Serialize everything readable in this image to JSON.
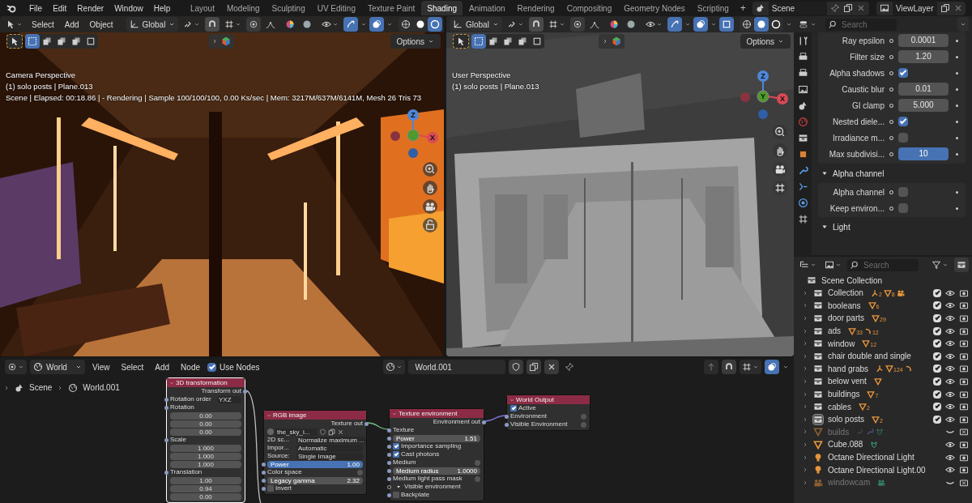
{
  "menu": [
    "File",
    "Edit",
    "Render",
    "Window",
    "Help"
  ],
  "workspaces": [
    {
      "label": "Layout",
      "selected": false
    },
    {
      "label": "Modeling",
      "selected": false
    },
    {
      "label": "Sculpting",
      "selected": false
    },
    {
      "label": "UV Editing",
      "selected": false
    },
    {
      "label": "Texture Paint",
      "selected": false
    },
    {
      "label": "Shading",
      "selected": true
    },
    {
      "label": "Animation",
      "selected": false
    },
    {
      "label": "Rendering",
      "selected": false
    },
    {
      "label": "Compositing",
      "selected": false
    },
    {
      "label": "Geometry Nodes",
      "selected": false
    },
    {
      "label": "Scripting",
      "selected": false
    }
  ],
  "add_workspace": "+",
  "scene_field": "Scene",
  "view_layer_field": "ViewLayer",
  "viewports": [
    {
      "menu": [
        "Select",
        "Add",
        "Object"
      ],
      "orientation": "Global",
      "options": "Options",
      "engine_panel_expanded": false,
      "shading": {
        "wireframe": false,
        "solid": false,
        "material": true
      },
      "overlay_lines": [
        "Camera Perspective",
        "(1) solo posts | Plane.013",
        "Scene | Elapsed: 00:18.86 |  - Rendering | Sample 100/100/100, 0.00 Ks/sec | Mem: 3217M/637M/6141M, Mesh 26 Tris 73"
      ],
      "gizmo_labels": [
        "Z",
        "X"
      ]
    },
    {
      "orientation": "Global",
      "options": "Options",
      "engine_panel_expanded": false,
      "shading": {
        "wireframe": false,
        "solid": true,
        "material": false
      },
      "overlay_lines": [
        "User Perspective",
        "(1) solo posts | Plane.013"
      ],
      "gizmo_labels": [
        "Z",
        "Y",
        "X"
      ]
    }
  ],
  "properties": {
    "search_placeholder": "Search",
    "rows": [
      {
        "kind": "number",
        "label": "Ray epsilon",
        "value": "0.0001",
        "active": false
      },
      {
        "kind": "number",
        "label": "Filter size",
        "value": "1.20",
        "active": false
      },
      {
        "kind": "checkbox",
        "label": "Alpha shadows",
        "checked": true
      },
      {
        "kind": "number",
        "label": "Caustic blur",
        "value": "0.01",
        "active": false
      },
      {
        "kind": "number",
        "label": "GI clamp",
        "value": "5.000",
        "active": false
      },
      {
        "kind": "checkbox",
        "label": "Nested diele...",
        "checked": true
      },
      {
        "kind": "checkbox",
        "label": "Irradiance m...",
        "checked": false
      },
      {
        "kind": "number",
        "label": "Max subdivisi...",
        "value": "10",
        "active": true
      }
    ],
    "panels": [
      {
        "title": "Alpha channel",
        "expanded": true,
        "rows": [
          {
            "kind": "checkbox",
            "label": "Alpha channel",
            "checked": false
          },
          {
            "kind": "checkbox",
            "label": "Keep environ...",
            "checked": false
          }
        ]
      },
      {
        "title": "Light",
        "expanded": true
      }
    ]
  },
  "outliner": {
    "search_placeholder": "Search",
    "root": "Scene Collection",
    "items": [
      {
        "kind": "collection",
        "name": "Collection",
        "included": true,
        "visible": true,
        "active": false,
        "badges": [
          {
            "kind": "armature",
            "count": "2"
          },
          {
            "kind": "mesh",
            "count": "8"
          },
          {
            "kind": "camera"
          }
        ]
      },
      {
        "kind": "collection",
        "name": "booleans",
        "included": true,
        "visible": true,
        "active": false,
        "badges": [
          {
            "kind": "mesh",
            "count": "6"
          }
        ]
      },
      {
        "kind": "collection",
        "name": "door parts",
        "included": true,
        "visible": true,
        "active": false,
        "badges": [
          {
            "kind": "mesh",
            "count": "29"
          }
        ]
      },
      {
        "kind": "collection",
        "name": "ads",
        "included": true,
        "visible": true,
        "active": false,
        "badges": [
          {
            "kind": "mesh",
            "count": "33"
          },
          {
            "kind": "curve",
            "count": "12"
          }
        ]
      },
      {
        "kind": "collection",
        "name": "window",
        "included": true,
        "visible": true,
        "active": false,
        "badges": [
          {
            "kind": "mesh",
            "count": "12"
          }
        ]
      },
      {
        "kind": "collection",
        "name": "chair double and single",
        "included": true,
        "visible": true,
        "active": false
      },
      {
        "kind": "collection",
        "name": "hand grabs",
        "included": true,
        "visible": true,
        "active": false,
        "badges": [
          {
            "kind": "armature"
          },
          {
            "kind": "mesh",
            "count": "124"
          },
          {
            "kind": "curve"
          }
        ]
      },
      {
        "kind": "collection",
        "name": "below vent",
        "included": true,
        "visible": true,
        "active": false,
        "badges": [
          {
            "kind": "mesh"
          }
        ]
      },
      {
        "kind": "collection",
        "name": "buildings",
        "included": true,
        "visible": true,
        "active": false,
        "badges": [
          {
            "kind": "mesh",
            "count": "7"
          }
        ]
      },
      {
        "kind": "collection",
        "name": "cables",
        "included": true,
        "visible": true,
        "active": false,
        "badges": [
          {
            "kind": "mesh",
            "count": "2"
          }
        ]
      },
      {
        "kind": "collection",
        "name": "solo posts",
        "included": true,
        "visible": true,
        "active": true,
        "badges": [
          {
            "kind": "mesh",
            "count": "2"
          }
        ]
      },
      {
        "kind": "mesh",
        "name": "builds",
        "visible": false,
        "active": false,
        "badges": [
          {
            "kind": "constraint"
          },
          {
            "kind": "modifier"
          },
          {
            "kind": "mesh_data"
          }
        ]
      },
      {
        "kind": "mesh",
        "name": "Cube.088",
        "visible": true,
        "active": false,
        "badges": [
          {
            "kind": "mesh_data"
          }
        ]
      },
      {
        "kind": "light",
        "name": "Octane Directional Light",
        "visible": true,
        "active": false
      },
      {
        "kind": "light",
        "name": "Octane Directional Light.00",
        "visible": true,
        "active": false
      },
      {
        "kind": "camera",
        "name": "windowcam",
        "visible": false,
        "active": false,
        "badges": [
          {
            "kind": "camera_data"
          }
        ]
      }
    ]
  },
  "node_editor": {
    "type_dropdown": "World",
    "menu": [
      "View",
      "Select",
      "Add",
      "Node"
    ],
    "use_nodes": {
      "label": "Use Nodes",
      "checked": true
    },
    "datablock": "World.001",
    "breadcrumb": [
      "Scene",
      "World.001"
    ],
    "nodes": [
      {
        "title": "3D transformation",
        "selected": true,
        "rows": [
          {
            "kind": "output",
            "label": "Transform out"
          },
          {
            "kind": "dropdown",
            "label": "Rotation order",
            "value": "YXZ"
          },
          {
            "kind": "input",
            "label": "Rotation"
          },
          {
            "kind": "value",
            "value": "0.00"
          },
          {
            "kind": "value",
            "value": "0.00"
          },
          {
            "kind": "value",
            "value": "0.00"
          },
          {
            "kind": "input",
            "label": "Scale"
          },
          {
            "kind": "value",
            "value": "1.000"
          },
          {
            "kind": "value",
            "value": "1.000"
          },
          {
            "kind": "value",
            "value": "1.000"
          },
          {
            "kind": "input",
            "label": "Translation"
          },
          {
            "kind": "value",
            "value": "1.00"
          },
          {
            "kind": "value",
            "value": "0.94"
          },
          {
            "kind": "value",
            "value": "0.00"
          }
        ]
      },
      {
        "title": "RGB image",
        "selected": false,
        "rows": [
          {
            "kind": "output",
            "label": "Texture out"
          },
          {
            "value": "the_sky_i..."
          },
          {
            "kind": "dropdown",
            "label": "2D sc...",
            "value": "Normalize maximum ..."
          },
          {
            "kind": "dropdown",
            "label": "Impor...",
            "value": "Automatic"
          },
          {
            "kind": "dropdown",
            "label": "Source:",
            "value": "Single Image"
          },
          {
            "kind": "slider",
            "label": "Power",
            "value": "1.00",
            "active": true
          },
          {
            "kind": "input_button",
            "label": "Color space"
          },
          {
            "kind": "slider",
            "label": "Legacy gamma",
            "value": "2.32",
            "active": false
          },
          {
            "kind": "checkbox",
            "label": "Invert",
            "checked": false
          }
        ]
      },
      {
        "title": "Texture environment",
        "selected": false,
        "rows": [
          {
            "kind": "output",
            "label": "Environment out"
          },
          {
            "kind": "input",
            "label": "Texture"
          },
          {
            "kind": "slider",
            "label": "Power",
            "value": "1.51",
            "active": false
          },
          {
            "kind": "checkbox",
            "label": "Importance sampling",
            "checked": true
          },
          {
            "kind": "checkbox",
            "label": "Cast photons",
            "checked": true
          },
          {
            "kind": "input_button",
            "label": "Medium"
          },
          {
            "kind": "slider",
            "label": "Medium radius",
            "value": "1.0000",
            "active": false
          },
          {
            "kind": "input_button",
            "label": "Medium light pass mask"
          },
          {
            "kind": "group",
            "label": "Visible environment"
          },
          {
            "kind": "checkbox",
            "label": "Backplate",
            "checked": false
          }
        ]
      },
      {
        "title": "World Output",
        "selected": false,
        "rows": [
          {
            "kind": "toggle",
            "label": "Active",
            "checked": true
          },
          {
            "kind": "input_button",
            "label": "Environment"
          },
          {
            "kind": "input_button",
            "label": "Visible Environment"
          }
        ]
      }
    ]
  }
}
